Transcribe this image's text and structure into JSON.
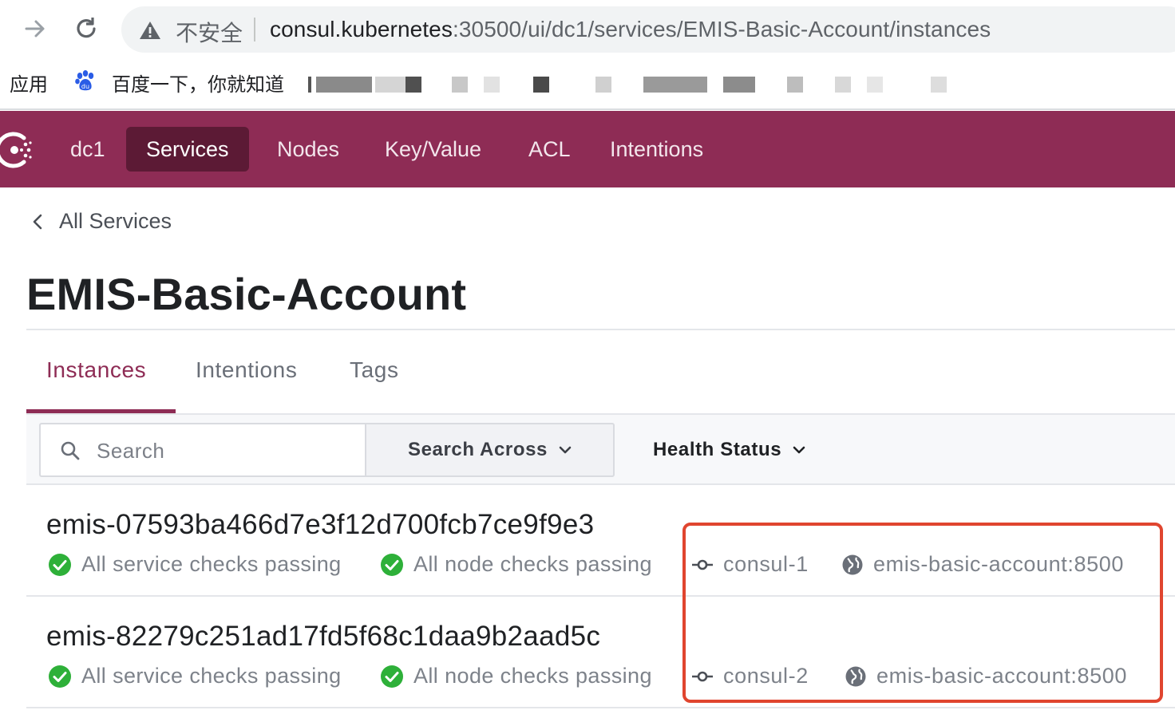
{
  "browser": {
    "security_label": "不安全",
    "url_host": "consul.kubernetes",
    "url_path": ":30500/ui/dc1/services/EMIS-Basic-Account/instances",
    "bookmarks": [
      {
        "label": "应用",
        "icon": "apps"
      },
      {
        "label": "百度一下，你就知道",
        "icon": "baidu-paw-icon"
      }
    ]
  },
  "header": {
    "datacenter": "dc1",
    "nav": [
      "Services",
      "Nodes",
      "Key/Value",
      "ACL",
      "Intentions"
    ],
    "active": "Services",
    "brand_color": "#8e2c55"
  },
  "breadcrumb": {
    "label": "All Services"
  },
  "page": {
    "title": "EMIS-Basic-Account"
  },
  "tabs": [
    {
      "label": "Instances",
      "active": true
    },
    {
      "label": "Intentions",
      "active": false
    },
    {
      "label": "Tags",
      "active": false
    }
  ],
  "filters": {
    "search_placeholder": "Search",
    "search_value": "",
    "search_across": "Search Across",
    "health_status": "Health Status"
  },
  "instances": [
    {
      "name": "emis-07593ba466d7e3f12d700fcb7ce9f9e3",
      "service_checks": "All service checks passing",
      "node_checks": "All node checks passing",
      "node": "consul-1",
      "address": "emis-basic-account:8500"
    },
    {
      "name": "emis-82279c251ad17fd5f68c1daa9b2aad5c",
      "service_checks": "All service checks passing",
      "node_checks": "All node checks passing",
      "node": "consul-2",
      "address": "emis-basic-account:8500"
    }
  ],
  "colors": {
    "passing": "#2eb039",
    "highlight": "#e0452f"
  }
}
